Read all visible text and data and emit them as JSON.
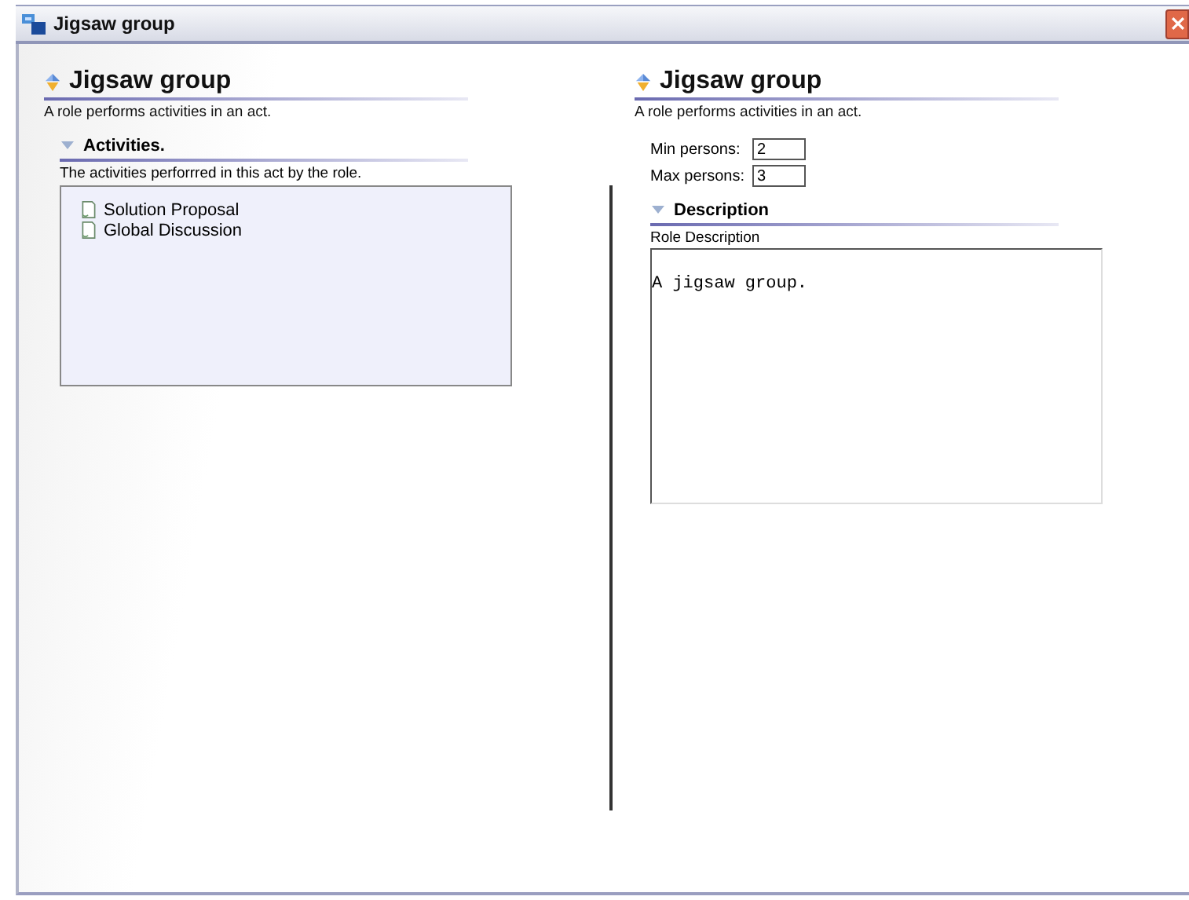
{
  "window": {
    "title": "Jigsaw group"
  },
  "left_panel": {
    "title": "Jigsaw group",
    "subtitle": "A role performs activities in an act.",
    "section": {
      "title": "Activities.",
      "expanded": true,
      "description": "The activities perforrred in this act by the role.",
      "items": [
        {
          "label": "Solution Proposal"
        },
        {
          "label": "Global Discussion"
        }
      ]
    }
  },
  "right_panel": {
    "title": "Jigsaw group",
    "subtitle": "A role performs activities in an act.",
    "fields": [
      {
        "label": "Min persons:",
        "value": "2"
      },
      {
        "label": "Max persons:",
        "value": "3"
      }
    ],
    "section": {
      "title": "Description",
      "expanded": true,
      "field_label": "Role Description",
      "text": "A jigsaw group."
    }
  }
}
